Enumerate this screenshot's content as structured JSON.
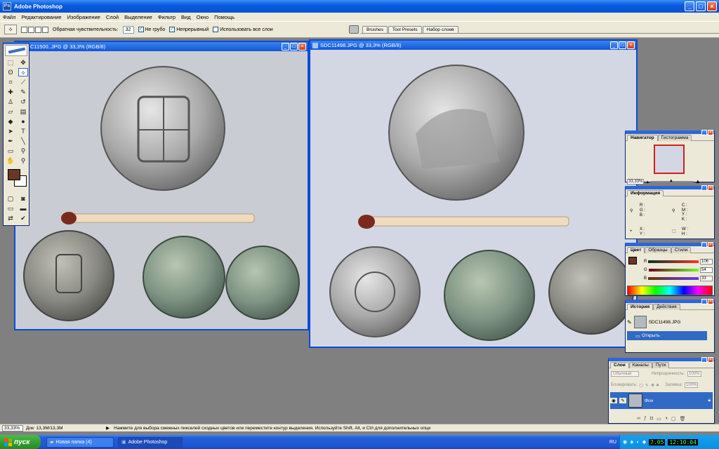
{
  "app": {
    "title": "Adobe Photoshop",
    "icon_label": "Ps"
  },
  "window_buttons": {
    "minimize": "_",
    "maximize": "□",
    "close": "×"
  },
  "menu": [
    "Файл",
    "Редактирование",
    "Изображение",
    "Слой",
    "Выделение",
    "Фильтр",
    "Вид",
    "Окно",
    "Помощь"
  ],
  "options": {
    "tolerance_label": "Обратная чувствительность:",
    "tolerance_value": "32",
    "antialias": "Не грубо",
    "contiguous": "Непрерывный",
    "all_layers": "Использовать все слои",
    "well_tabs": [
      "Brushes",
      "Tool Presets",
      "Набор слоев"
    ]
  },
  "doc1": {
    "title": "C11500..JPG @ 33,3% (RGB/8)"
  },
  "doc2": {
    "title": "SDC11498.JPG @ 33,3% (RGB/8)"
  },
  "navigator": {
    "tabs": [
      "Навигатор",
      "Гистограмма"
    ],
    "zoom": "33,33%"
  },
  "info": {
    "tab": "Информация",
    "rgb": [
      "R :",
      "G :",
      "B :"
    ],
    "cmyk": [
      "C :",
      "M :",
      "Y :",
      "K :"
    ],
    "xy": [
      "X :",
      "Y :"
    ],
    "wh": [
      "W :",
      "H :"
    ]
  },
  "color": {
    "tabs": [
      "Цвет",
      "Образцы",
      "Стили"
    ],
    "r": "106",
    "g": "54",
    "b": "33",
    "r_label": "R",
    "g_label": "G",
    "b_label": "B",
    "fg": "#6a3626"
  },
  "history": {
    "tabs": [
      "История",
      "Действия"
    ],
    "snapshot": "SDC11498.JPG",
    "step": "Открыть"
  },
  "layers": {
    "tabs": [
      "Слои",
      "Каналы",
      "Пути"
    ],
    "blend": "Обычный",
    "opacity_label": "Непрозрачность:",
    "opacity": "100%",
    "lock_label": "Блокировать:",
    "fill_label": "Заливка:",
    "fill": "100%",
    "layer_name": "Фон"
  },
  "status": {
    "zoom": "33,33%",
    "doc": "Док: 13,3M/13,3M",
    "hint": "Нажмите для выбора смежных пикселей сходных цветов или переместите контур выделения. Используйте Shift, Alt, и Ctrl для дополнительных опци"
  },
  "taskbar": {
    "start": "пуск",
    "items": [
      "Новая папка (4)",
      "Adobe Photoshop"
    ],
    "lang": "RU",
    "date": "7.05",
    "time": "12:10:04"
  }
}
